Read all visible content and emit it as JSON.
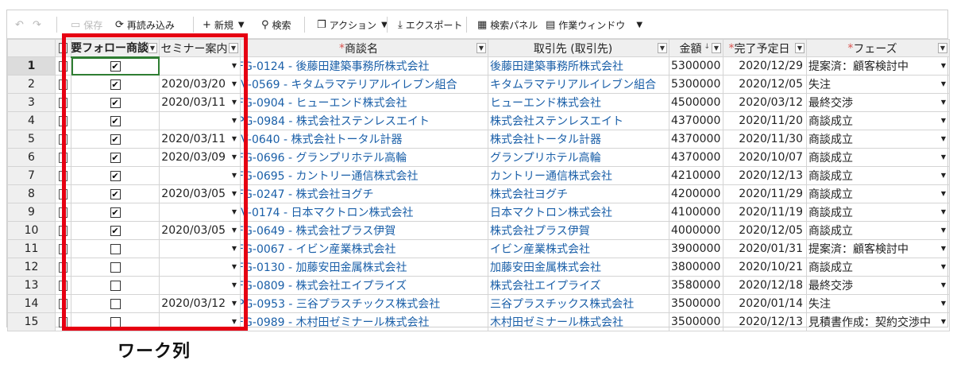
{
  "toolbar": {
    "undo_icon": "undo-icon",
    "redo_icon": "redo-icon",
    "save": "保存",
    "reload": "再読み込み",
    "new": "新規",
    "search": "検索",
    "action": "アクション",
    "export": "エクスポート",
    "search_panel": "検索パネル",
    "work_window": "作業ウィンドウ"
  },
  "columns": {
    "follow": "要フォロー商談",
    "seminar": "セミナー案内",
    "deal_name": "商談名",
    "client": "取引先 (取引先)",
    "amount": "金額",
    "due": "完了予定日",
    "phase": "フェーズ",
    "required_mark": "*"
  },
  "rows": [
    {
      "no": "1",
      "follow": true,
      "seminar": "",
      "deal": "FG-0124 - 後藤田建築事務所株式会社",
      "client": "後藤田建築事務所株式会社",
      "amount": "5300000",
      "due": "2020/12/29",
      "phase": "提案済：顧客検討中"
    },
    {
      "no": "2",
      "follow": true,
      "seminar": "2020/03/20",
      "deal": "IV-0569 - キタムラマテリアルイレブン組合",
      "client": "キタムラマテリアルイレブン組合",
      "amount": "5300000",
      "due": "2020/12/05",
      "phase": "失注"
    },
    {
      "no": "3",
      "follow": true,
      "seminar": "2020/03/11",
      "deal": "FG-0904 - ヒューエンド株式会社",
      "client": "ヒューエンド株式会社",
      "amount": "4500000",
      "due": "2020/03/12",
      "phase": "最終交渉"
    },
    {
      "no": "4",
      "follow": true,
      "seminar": "",
      "deal": "PG-0984 - 株式会社ステンレスエイト",
      "client": "株式会社ステンレスエイト",
      "amount": "4370000",
      "due": "2020/11/20",
      "phase": "商談成立"
    },
    {
      "no": "5",
      "follow": true,
      "seminar": "2020/03/11",
      "deal": "IV-0640 - 株式会社トータル計器",
      "client": "株式会社トータル計器",
      "amount": "4370000",
      "due": "2020/11/30",
      "phase": "商談成立"
    },
    {
      "no": "6",
      "follow": true,
      "seminar": "2020/03/09",
      "deal": "FG-0696 - グランプリホテル高輪",
      "client": "グランプリホテル高輪",
      "amount": "4370000",
      "due": "2020/10/07",
      "phase": "商談成立"
    },
    {
      "no": "7",
      "follow": true,
      "seminar": "",
      "deal": "FG-0695 - カントリー通信株式会社",
      "client": "カントリー通信株式会社",
      "amount": "4210000",
      "due": "2020/12/13",
      "phase": "商談成立"
    },
    {
      "no": "8",
      "follow": true,
      "seminar": "2020/03/05",
      "deal": "FG-0247 - 株式会社ヨグチ",
      "client": "株式会社ヨグチ",
      "amount": "4200000",
      "due": "2020/11/29",
      "phase": "商談成立"
    },
    {
      "no": "9",
      "follow": true,
      "seminar": "",
      "deal": "IV-0174 - 日本マクトロン株式会社",
      "client": "日本マクトロン株式会社",
      "amount": "4100000",
      "due": "2020/11/19",
      "phase": "商談成立"
    },
    {
      "no": "10",
      "follow": true,
      "seminar": "2020/03/05",
      "deal": "FG-0649 - 株式会社プラス伊賀",
      "client": "株式会社プラス伊賀",
      "amount": "4000000",
      "due": "2020/12/05",
      "phase": "商談成立"
    },
    {
      "no": "11",
      "follow": false,
      "seminar": "",
      "deal": "FG-0067 - イビン産業株式会社",
      "client": "イビン産業株式会社",
      "amount": "3900000",
      "due": "2020/01/31",
      "phase": "提案済：顧客検討中"
    },
    {
      "no": "12",
      "follow": false,
      "seminar": "",
      "deal": "FG-0130 - 加藤安田金属株式会社",
      "client": "加藤安田金属株式会社",
      "amount": "3800000",
      "due": "2020/10/21",
      "phase": "商談成立"
    },
    {
      "no": "13",
      "follow": false,
      "seminar": "",
      "deal": "FG-0809 - 株式会社エイプライズ",
      "client": "株式会社エイプライズ",
      "amount": "3580000",
      "due": "2020/12/18",
      "phase": "最終交渉"
    },
    {
      "no": "14",
      "follow": false,
      "seminar": "2020/03/12",
      "deal": "PG-0953 - 三谷プラスチックス株式会社",
      "client": "三谷プラスチックス株式会社",
      "amount": "3500000",
      "due": "2020/01/14",
      "phase": "失注"
    },
    {
      "no": "15",
      "follow": false,
      "seminar": "",
      "deal": "FG-0989 - 木村田ゼミナール株式会社",
      "client": "木村田ゼミナール株式会社",
      "amount": "3500000",
      "due": "2020/12/13",
      "phase": "見積書作成：契約交渉中"
    }
  ],
  "caption": "ワーク列",
  "colors": {
    "highlight": "#e60012",
    "link": "#1a5fa8",
    "active": "#2e7d32"
  }
}
